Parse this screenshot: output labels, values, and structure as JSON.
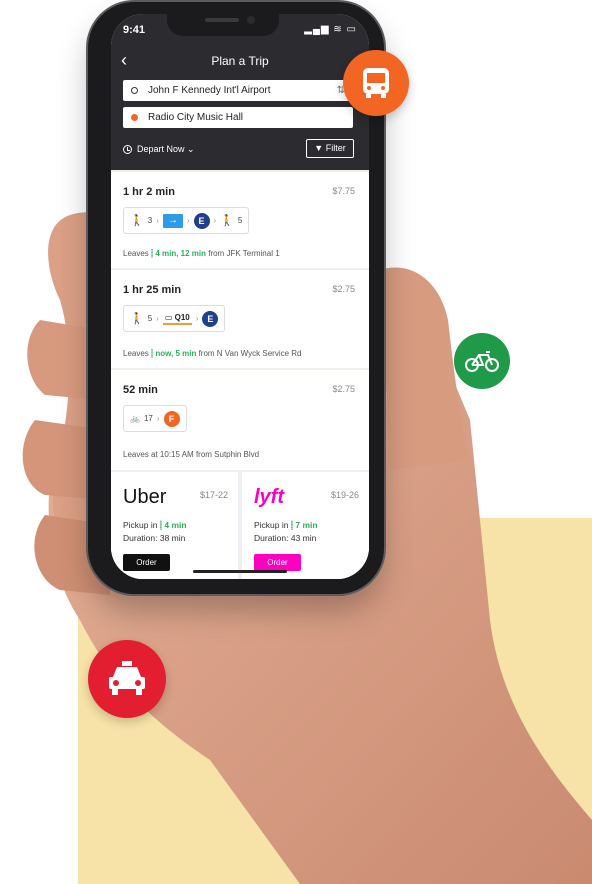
{
  "status": {
    "time": "9:41",
    "icons": "▂▄▆ ≋ ▭"
  },
  "header": {
    "back": "‹",
    "title": "Plan a Trip"
  },
  "trip": {
    "from": "John F Kennedy Int'l Airport",
    "to": "Radio City Music Hall",
    "depart": "Depart Now ⌄",
    "filter": "Filter",
    "swap": "⇅"
  },
  "routes": [
    {
      "duration": "1 hr 2 min",
      "price": "$7.75",
      "walk1": "3",
      "line": "E",
      "walk2": "5",
      "leaves_prefix": "Leaves ",
      "leaves_times": "4 min, 12 min",
      "leaves_suffix": " from JFK Terminal 1"
    },
    {
      "duration": "1 hr 25 min",
      "price": "$2.75",
      "walk1": "5",
      "bus": "Q10",
      "line": "E",
      "leaves_prefix": "Leaves ",
      "leaves_times": "now, 5 min",
      "leaves_suffix": " from N Van Wyck Service Rd"
    },
    {
      "duration": "52 min",
      "price": "$2.75",
      "bike": "17",
      "line": "F",
      "leaves": "Leaves at 10:15 AM from Sutphin Blvd"
    }
  ],
  "rides": [
    {
      "name": "Uber",
      "price": "$17-22",
      "pickup_prefix": "Pickup in ",
      "pickup": "4 min",
      "duration": "Duration: 38 min",
      "order": "Order"
    },
    {
      "name": "lyft",
      "price": "$19-26",
      "pickup_prefix": "Pickup in ",
      "pickup": "7 min",
      "duration": "Duration: 43 min",
      "order": "Order"
    }
  ],
  "colors": {
    "bus_badge": "#f26522",
    "bike_badge": "#1f9a48",
    "taxi_badge": "#e41e31",
    "line_e": "#1f3f8f",
    "line_f": "#f26522",
    "lyft": "#ff00bf",
    "green": "#2bb05a"
  }
}
